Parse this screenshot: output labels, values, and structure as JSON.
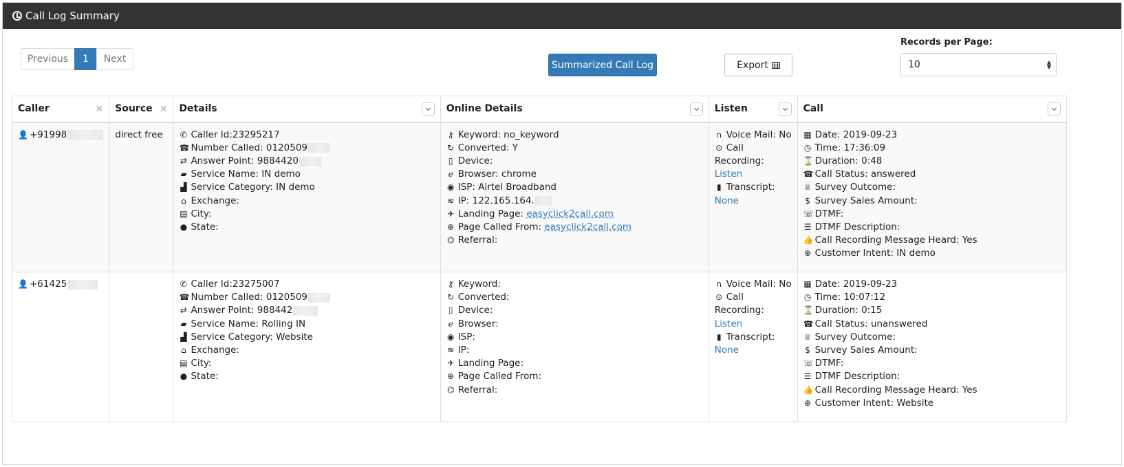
{
  "panel": {
    "title": "Call Log Summary"
  },
  "pagination": {
    "previous": "Previous",
    "page": "1",
    "next": "Next"
  },
  "buttons": {
    "summarized": "Summarized Call Log",
    "export": "Export"
  },
  "records_per_page": {
    "label": "Records per Page:",
    "value": "10"
  },
  "columns": {
    "caller": "Caller",
    "source": "Source",
    "details": "Details",
    "online_details": "Online Details",
    "listen": "Listen",
    "call": "Call"
  },
  "rows": [
    {
      "caller": "+91998",
      "source": "direct free",
      "details": {
        "caller_id": "Caller Id:23295217",
        "number_called": "Number Called: 0120509",
        "answer_point": "Answer Point: 9884420",
        "service_name": "Service Name: IN demo",
        "service_category": "Service Category: IN demo",
        "exchange": "Exchange:",
        "city": "City:",
        "state": "State:"
      },
      "online": {
        "keyword": "Keyword: no_keyword",
        "converted": "Converted: Y",
        "device": "Device:",
        "browser": "Browser: chrome",
        "isp": "ISP: Airtel Broadband",
        "ip": "IP: 122.165.164.",
        "landing_label": "Landing Page:",
        "landing_link": "easyclick2call.com",
        "called_from_label": "Page Called From:",
        "called_from_link": "easyclick2call.com",
        "referral": "Referral:"
      },
      "listen": {
        "voice_mail": "Voice Mail: No",
        "call_recording_1": "Call",
        "call_recording_2": "Recording:",
        "listen_link": "Listen",
        "transcript": "Transcript:",
        "transcript_value": "None"
      },
      "call": {
        "date": "Date: 2019-09-23",
        "time": "Time: 17:36:09",
        "duration": "Duration: 0:48",
        "status": "Call Status: answered",
        "survey_outcome": "Survey Outcome:",
        "survey_sales": "Survey Sales Amount:",
        "dtmf": "DTMF:",
        "dtmf_desc": "DTMF Description:",
        "recording_heard": "Call Recording Message Heard: Yes",
        "intent": "Customer Intent: IN demo"
      }
    },
    {
      "caller": "+61425",
      "source": "",
      "details": {
        "caller_id": "Caller Id:23275007",
        "number_called": "Number Called: 0120509",
        "answer_point": "Answer Point: 988442",
        "service_name": "Service Name: Rolling IN",
        "service_category": "Service Category: Website",
        "exchange": "Exchange:",
        "city": "City:",
        "state": "State:"
      },
      "online": {
        "keyword": "Keyword:",
        "converted": "Converted:",
        "device": "Device:",
        "browser": "Browser:",
        "isp": "ISP:",
        "ip": "IP:",
        "landing_label": "Landing Page:",
        "landing_link": "",
        "called_from_label": "Page Called From:",
        "called_from_link": "",
        "referral": "Referral:"
      },
      "listen": {
        "voice_mail": "Voice Mail: No",
        "call_recording_1": "Call",
        "call_recording_2": "Recording:",
        "listen_link": "Listen",
        "transcript": "Transcript:",
        "transcript_value": "None"
      },
      "call": {
        "date": "Date: 2019-09-23",
        "time": "Time: 10:07:12",
        "duration": "Duration: 0:15",
        "status": "Call Status: unanswered",
        "survey_outcome": "Survey Outcome:",
        "survey_sales": "Survey Sales Amount:",
        "dtmf": "DTMF:",
        "dtmf_desc": "DTMF Description:",
        "recording_heard": "Call Recording Message Heard: Yes",
        "intent": "Customer Intent: Website"
      }
    }
  ]
}
